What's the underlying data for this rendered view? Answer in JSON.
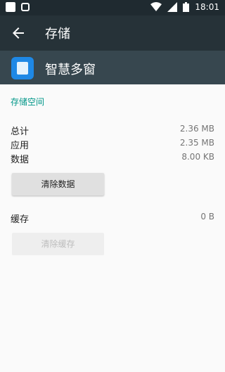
{
  "status": {
    "time": "18:01"
  },
  "toolbar": {
    "title": "存储"
  },
  "app": {
    "name": "智慧多窗"
  },
  "storage": {
    "section_title": "存储空间",
    "rows": [
      {
        "label": "总计",
        "value": "2.36 MB"
      },
      {
        "label": "应用",
        "value": "2.35 MB"
      },
      {
        "label": "数据",
        "value": "8.00 KB"
      }
    ],
    "clear_data_label": "清除数据",
    "cache_label": "缓存",
    "cache_value": "0 B",
    "clear_cache_label": "清除缓存"
  },
  "colors": {
    "accent": "#009688",
    "toolbar": "#263238",
    "header": "#37474f"
  }
}
